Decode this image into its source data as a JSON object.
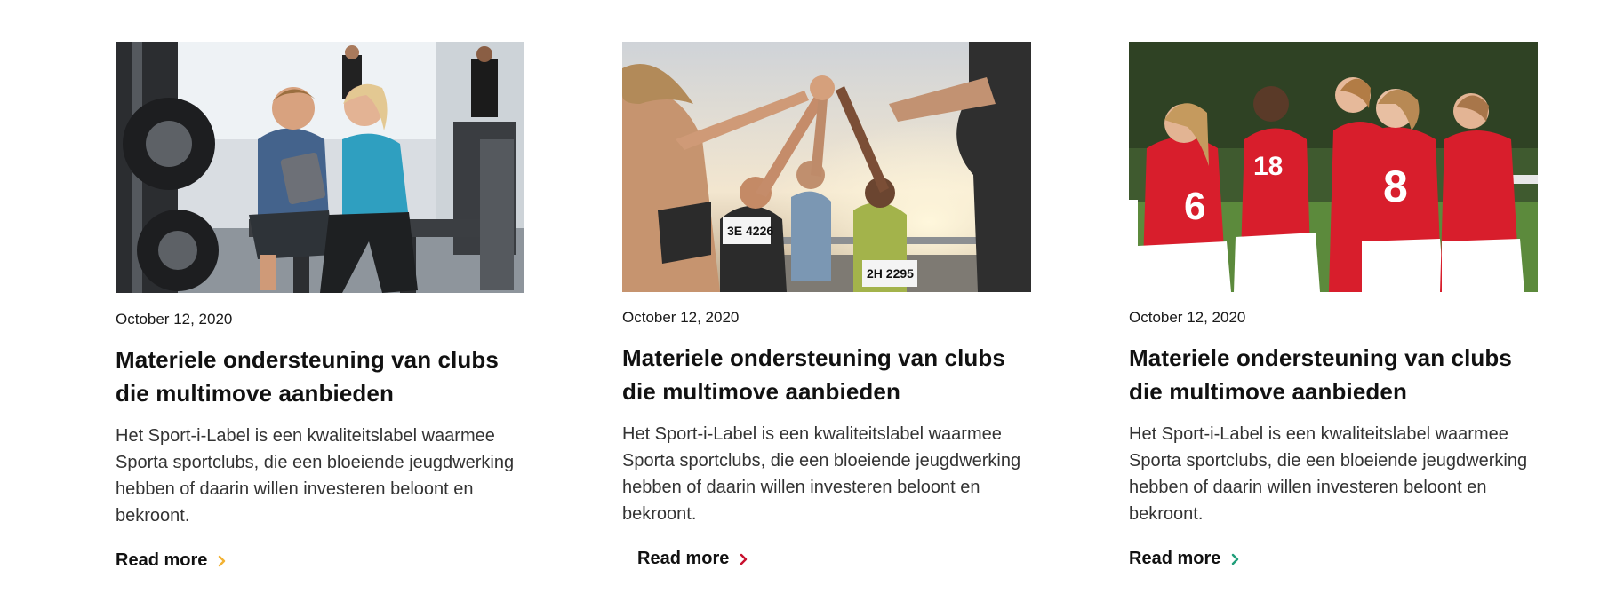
{
  "cards": [
    {
      "date": "October 12, 2020",
      "title": "Materiele ondersteuning van clubs die multimove aanbieden",
      "excerpt": "Het Sport-i-Label is een kwaliteitslabel waarmee Sporta sportclubs, die een bloeiende jeugdwerking hebben of daarin willen investeren beloont en bekroont.",
      "read_more": "Read more",
      "accent_color": "#f2b233",
      "image_alt": "Gym coach with tablet"
    },
    {
      "date": "October 12, 2020",
      "title": "Materiele ondersteuning van clubs die multimove aanbieden",
      "excerpt": "Het Sport-i-Label is een kwaliteitslabel waarmee Sporta sportclubs, die een bloeiende jeugdwerking hebben of daarin willen investeren beloont en bekroont.",
      "read_more": "Read more",
      "accent_color": "#c8102e",
      "image_alt": "Runners high five at sunset",
      "bib_1": "3E 4226",
      "bib_2": "2H 2295"
    },
    {
      "date": "October 12, 2020",
      "title": "Materiele ondersteuning van clubs die multimove aanbieden",
      "excerpt": "Het Sport-i-Label is een kwaliteitslabel waarmee Sporta sportclubs, die een bloeiende jeugdwerking hebben of daarin willen investeren beloont en bekroont.",
      "read_more": "Read more",
      "accent_color": "#1f9e7a",
      "image_alt": "Football team celebrating",
      "shirt_1": "6",
      "shirt_2": "8",
      "shirt_3": "18"
    }
  ]
}
